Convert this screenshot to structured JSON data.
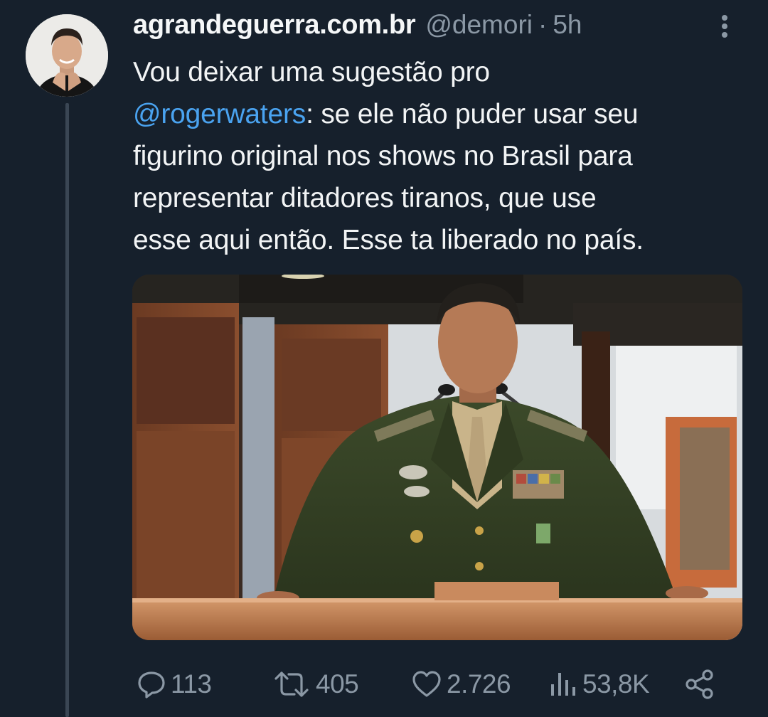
{
  "author": {
    "display_name": "agrandeguerra.com.br",
    "handle": "@demori",
    "separator": "·",
    "time": "5h"
  },
  "tweet": {
    "line1": "Vou deixar uma sugestão pro",
    "mention": "@rogerwaters",
    "line2_rest": ": se ele não puder usar seu",
    "line3": "figurino original nos shows no Brasil para",
    "line4": "representar ditadores tiranos, que use",
    "line5": "esse aqui então. Esse ta liberado no país."
  },
  "actions": {
    "replies": "113",
    "retweets": "405",
    "likes": "2.726",
    "views": "53,8K"
  },
  "icons": {
    "reply": "reply-icon",
    "retweet": "retweet-icon",
    "like": "heart-icon",
    "views": "views-icon",
    "share": "share-icon",
    "more": "more-vertical-icon"
  },
  "colors": {
    "background": "#16202c",
    "text": "#f2f4f5",
    "muted": "#8b98a5",
    "mention": "#4aa3f0"
  }
}
